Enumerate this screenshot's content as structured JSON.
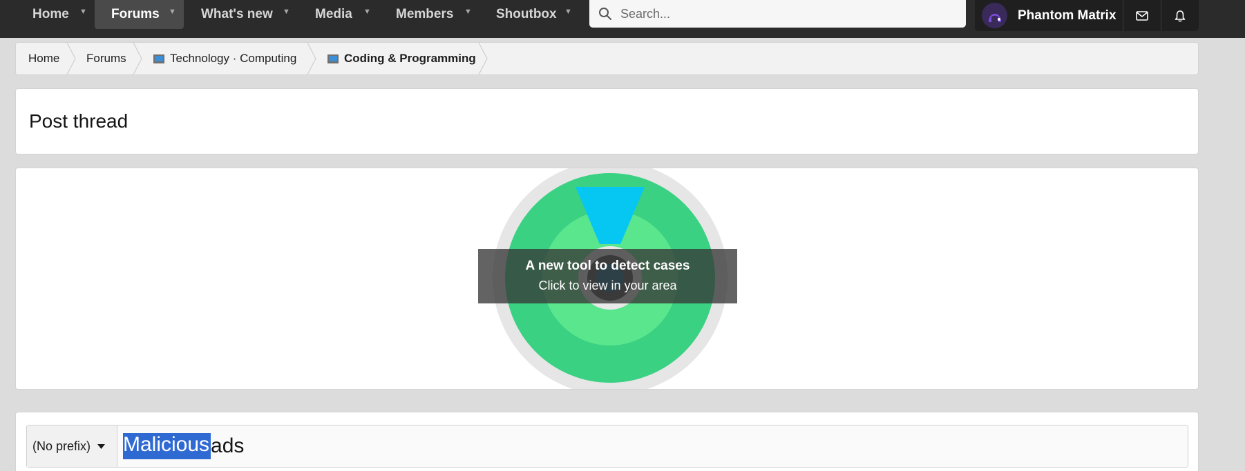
{
  "nav": {
    "tabs": [
      {
        "label": "Home",
        "active": false
      },
      {
        "label": "Forums",
        "active": true
      },
      {
        "label": "What's new",
        "active": false
      },
      {
        "label": "Media",
        "active": false
      },
      {
        "label": "Members",
        "active": false
      },
      {
        "label": "Shoutbox",
        "active": false
      }
    ],
    "search_placeholder": "Search...",
    "user": {
      "name": "Phantom Matrix"
    },
    "icons": {
      "search": "search-icon",
      "messages": "envelope-icon",
      "alerts": "bell-icon",
      "menu_caret": "chevron-down-icon"
    }
  },
  "breadcrumb": [
    {
      "label": "Home",
      "icon": null
    },
    {
      "label": "Forums",
      "icon": null
    },
    {
      "label": "Technology · Computing",
      "icon": "computer-icon"
    },
    {
      "label": "Coding & Programming",
      "icon": "computer-icon",
      "current": true
    }
  ],
  "page": {
    "title": "Post thread"
  },
  "ad": {
    "headline": "A new tool to detect cases",
    "subline": "Click to view in your area"
  },
  "form": {
    "prefix": "(No prefix)",
    "thread_title": {
      "selected_text": "Malicious ",
      "remaining_text": "ads"
    }
  },
  "colors": {
    "topbar": "#2b2b2b",
    "active_tab": "#4a4a4a",
    "selection": "#2f6ad3",
    "ad_green": "#3ad183",
    "ad_light_green": "#5ae68c",
    "ad_cyan": "#06c6f2"
  }
}
